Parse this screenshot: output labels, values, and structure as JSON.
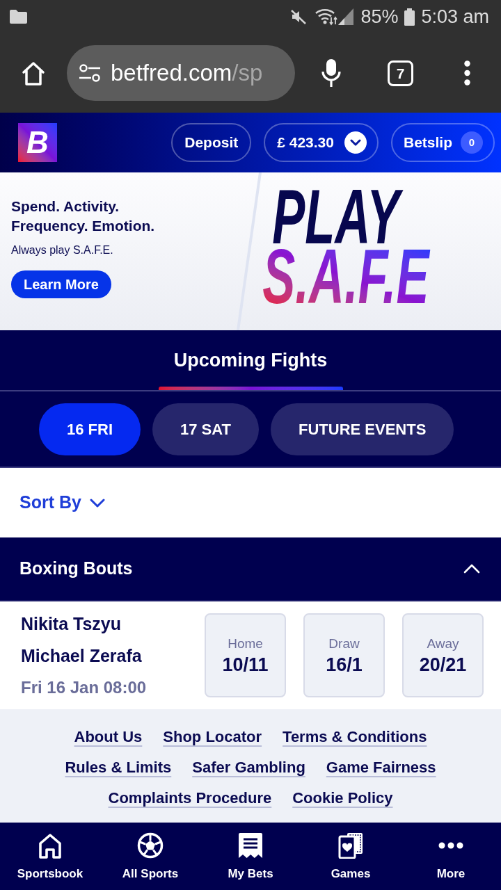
{
  "status_bar": {
    "battery": "85%",
    "time": "5:03 am"
  },
  "browser": {
    "url_host": "betfred.com",
    "url_path": "/sp",
    "tab_count": "7"
  },
  "header": {
    "logo": "B",
    "deposit": "Deposit",
    "balance": "£ 423.30",
    "betslip": "Betslip",
    "betslip_count": "0"
  },
  "banner": {
    "headline": "Spend. Activity.\nFrequency. Emotion.",
    "subtext": "Always play S.A.F.E.",
    "button": "Learn More",
    "art": {
      "top": "PLAY",
      "bottom": "S.A.F.E"
    }
  },
  "section_tabs": [
    {
      "label": "Upcoming Fights",
      "selected": true
    }
  ],
  "date_tabs": [
    {
      "label": "16 FRI",
      "selected": true
    },
    {
      "label": "17 SAT",
      "selected": false
    },
    {
      "label": "FUTURE EVENTS",
      "selected": false
    }
  ],
  "sort": {
    "label": "Sort By"
  },
  "group": {
    "title": "Boxing Bouts",
    "expanded": true
  },
  "events": [
    {
      "home": "Nikita Tszyu",
      "away": "Michael Zerafa",
      "start": "Fri 16 Jan 08:00",
      "odds": [
        {
          "label": "Home",
          "price": "10/11"
        },
        {
          "label": "Draw",
          "price": "16/1"
        },
        {
          "label": "Away",
          "price": "20/21"
        }
      ]
    }
  ],
  "footer_links": [
    "About Us",
    "Shop Locator",
    "Terms & Conditions",
    "Rules & Limits",
    "Safer Gambling",
    "Game Fairness",
    "Complaints Procedure",
    "Cookie Policy"
  ],
  "bottom_nav": [
    {
      "label": "Sportsbook",
      "kind": "home"
    },
    {
      "label": "All Sports",
      "kind": "ball"
    },
    {
      "label": "My Bets",
      "kind": "receipt"
    },
    {
      "label": "Games",
      "kind": "cards"
    },
    {
      "label": "More",
      "kind": "dots"
    }
  ]
}
